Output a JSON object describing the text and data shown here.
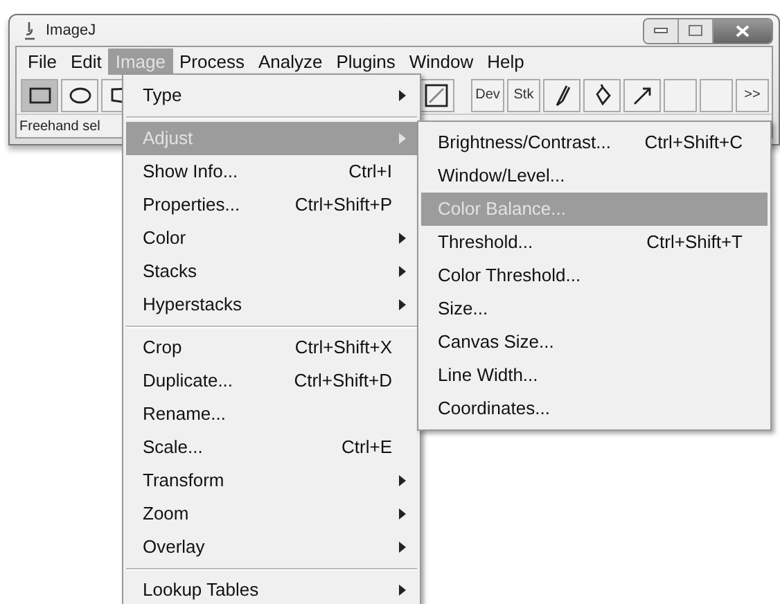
{
  "window": {
    "title": "ImageJ"
  },
  "menu_bar": [
    {
      "label": "File",
      "selected": false
    },
    {
      "label": "Edit",
      "selected": false
    },
    {
      "label": "Image",
      "selected": true
    },
    {
      "label": "Process",
      "selected": false
    },
    {
      "label": "Analyze",
      "selected": false
    },
    {
      "label": "Plugins",
      "selected": false
    },
    {
      "label": "Window",
      "selected": false
    },
    {
      "label": "Help",
      "selected": false
    }
  ],
  "toolbar_left": [
    {
      "kind": "rectangle",
      "selected": true
    },
    {
      "kind": "oval",
      "selected": false
    },
    {
      "kind": "polygon",
      "selected": false
    }
  ],
  "toolbar_right": [
    {
      "kind": "line",
      "selected": false
    },
    {
      "kind": "text",
      "label": "Dev",
      "selected": false
    },
    {
      "kind": "text",
      "label": "Stk",
      "selected": false
    },
    {
      "kind": "brush",
      "selected": false
    },
    {
      "kind": "fill",
      "selected": false
    },
    {
      "kind": "arrow",
      "selected": false
    },
    {
      "kind": "empty",
      "selected": false
    },
    {
      "kind": "empty",
      "selected": false
    },
    {
      "kind": "more",
      "label": ">>",
      "selected": false
    }
  ],
  "status_bar": {
    "text": "Freehand sel"
  },
  "image_menu": [
    {
      "kind": "item",
      "label": "Type",
      "submenu": true,
      "selected": false
    },
    {
      "kind": "separator"
    },
    {
      "kind": "item",
      "label": "Adjust",
      "submenu": true,
      "selected": true
    },
    {
      "kind": "item",
      "label": "Show Info...",
      "shortcut": "Ctrl+I",
      "submenu": false,
      "selected": false
    },
    {
      "kind": "item",
      "label": "Properties...",
      "shortcut": "Ctrl+Shift+P",
      "submenu": false,
      "selected": false
    },
    {
      "kind": "item",
      "label": "Color",
      "submenu": true,
      "selected": false
    },
    {
      "kind": "item",
      "label": "Stacks",
      "submenu": true,
      "selected": false
    },
    {
      "kind": "item",
      "label": "Hyperstacks",
      "submenu": true,
      "selected": false
    },
    {
      "kind": "separator"
    },
    {
      "kind": "item",
      "label": "Crop",
      "shortcut": "Ctrl+Shift+X",
      "submenu": false,
      "selected": false
    },
    {
      "kind": "item",
      "label": "Duplicate...",
      "shortcut": "Ctrl+Shift+D",
      "submenu": false,
      "selected": false
    },
    {
      "kind": "item",
      "label": "Rename...",
      "submenu": false,
      "selected": false
    },
    {
      "kind": "item",
      "label": "Scale...",
      "shortcut": "Ctrl+E",
      "submenu": false,
      "selected": false
    },
    {
      "kind": "item",
      "label": "Transform",
      "submenu": true,
      "selected": false
    },
    {
      "kind": "item",
      "label": "Zoom",
      "submenu": true,
      "selected": false
    },
    {
      "kind": "item",
      "label": "Overlay",
      "submenu": true,
      "selected": false
    },
    {
      "kind": "separator"
    },
    {
      "kind": "item",
      "label": "Lookup Tables",
      "submenu": true,
      "selected": false
    }
  ],
  "adjust_submenu": [
    {
      "kind": "item",
      "label": "Brightness/Contrast...",
      "shortcut": "Ctrl+Shift+C",
      "submenu": false,
      "selected": false
    },
    {
      "kind": "item",
      "label": "Window/Level...",
      "submenu": false,
      "selected": false
    },
    {
      "kind": "item",
      "label": "Color Balance...",
      "submenu": false,
      "selected": true
    },
    {
      "kind": "item",
      "label": "Threshold...",
      "shortcut": "Ctrl+Shift+T",
      "submenu": false,
      "selected": false
    },
    {
      "kind": "item",
      "label": "Color Threshold...",
      "submenu": false,
      "selected": false
    },
    {
      "kind": "item",
      "label": "Size...",
      "submenu": false,
      "selected": false
    },
    {
      "kind": "item",
      "label": "Canvas Size...",
      "submenu": false,
      "selected": false
    },
    {
      "kind": "item",
      "label": "Line Width...",
      "submenu": false,
      "selected": false
    },
    {
      "kind": "item",
      "label": "Coordinates...",
      "submenu": false,
      "selected": false
    }
  ]
}
